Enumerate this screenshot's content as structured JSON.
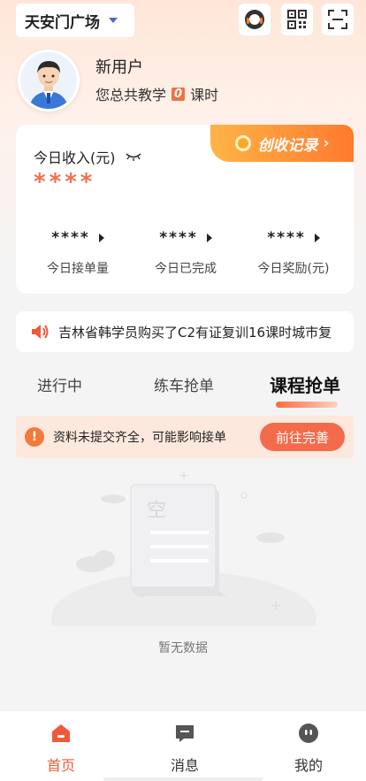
{
  "header": {
    "location": "天安门广场",
    "icons": [
      "headset-icon",
      "qr-code-icon",
      "scan-icon"
    ]
  },
  "user": {
    "name": "新用户",
    "teach_prefix": "您总共教学",
    "teach_count": "0",
    "teach_suffix": "课时"
  },
  "income": {
    "title": "今日收入(元)",
    "masked_value": "****",
    "record_label": "创收记录",
    "stats": [
      {
        "value": "****",
        "label": "今日接单量"
      },
      {
        "value": "****",
        "label": "今日已完成"
      },
      {
        "value": "****",
        "label": "今日奖励(元)"
      }
    ]
  },
  "notice": {
    "text": "吉林省韩学员购买了C2有证复训16课时城市复"
  },
  "tabs": [
    {
      "label": "进行中",
      "active": false
    },
    {
      "label": "练车抢单",
      "active": false
    },
    {
      "label": "课程抢单",
      "active": true
    }
  ],
  "warning": {
    "icon": "!",
    "text": "资料未提交齐全，可能影响接单",
    "button": "前往完善"
  },
  "empty": {
    "illustration_char": "空",
    "text": "暂无数据"
  },
  "bottom_nav": [
    {
      "label": "首页",
      "icon": "home-icon",
      "active": true
    },
    {
      "label": "消息",
      "icon": "message-icon",
      "active": false
    },
    {
      "label": "我的",
      "icon": "profile-icon",
      "active": false
    }
  ],
  "colors": {
    "accent": "#f05a3a",
    "badge_gradient_start": "#ffb347",
    "badge_gradient_end": "#ff7a2e",
    "warning_bg": "#fde8de"
  }
}
